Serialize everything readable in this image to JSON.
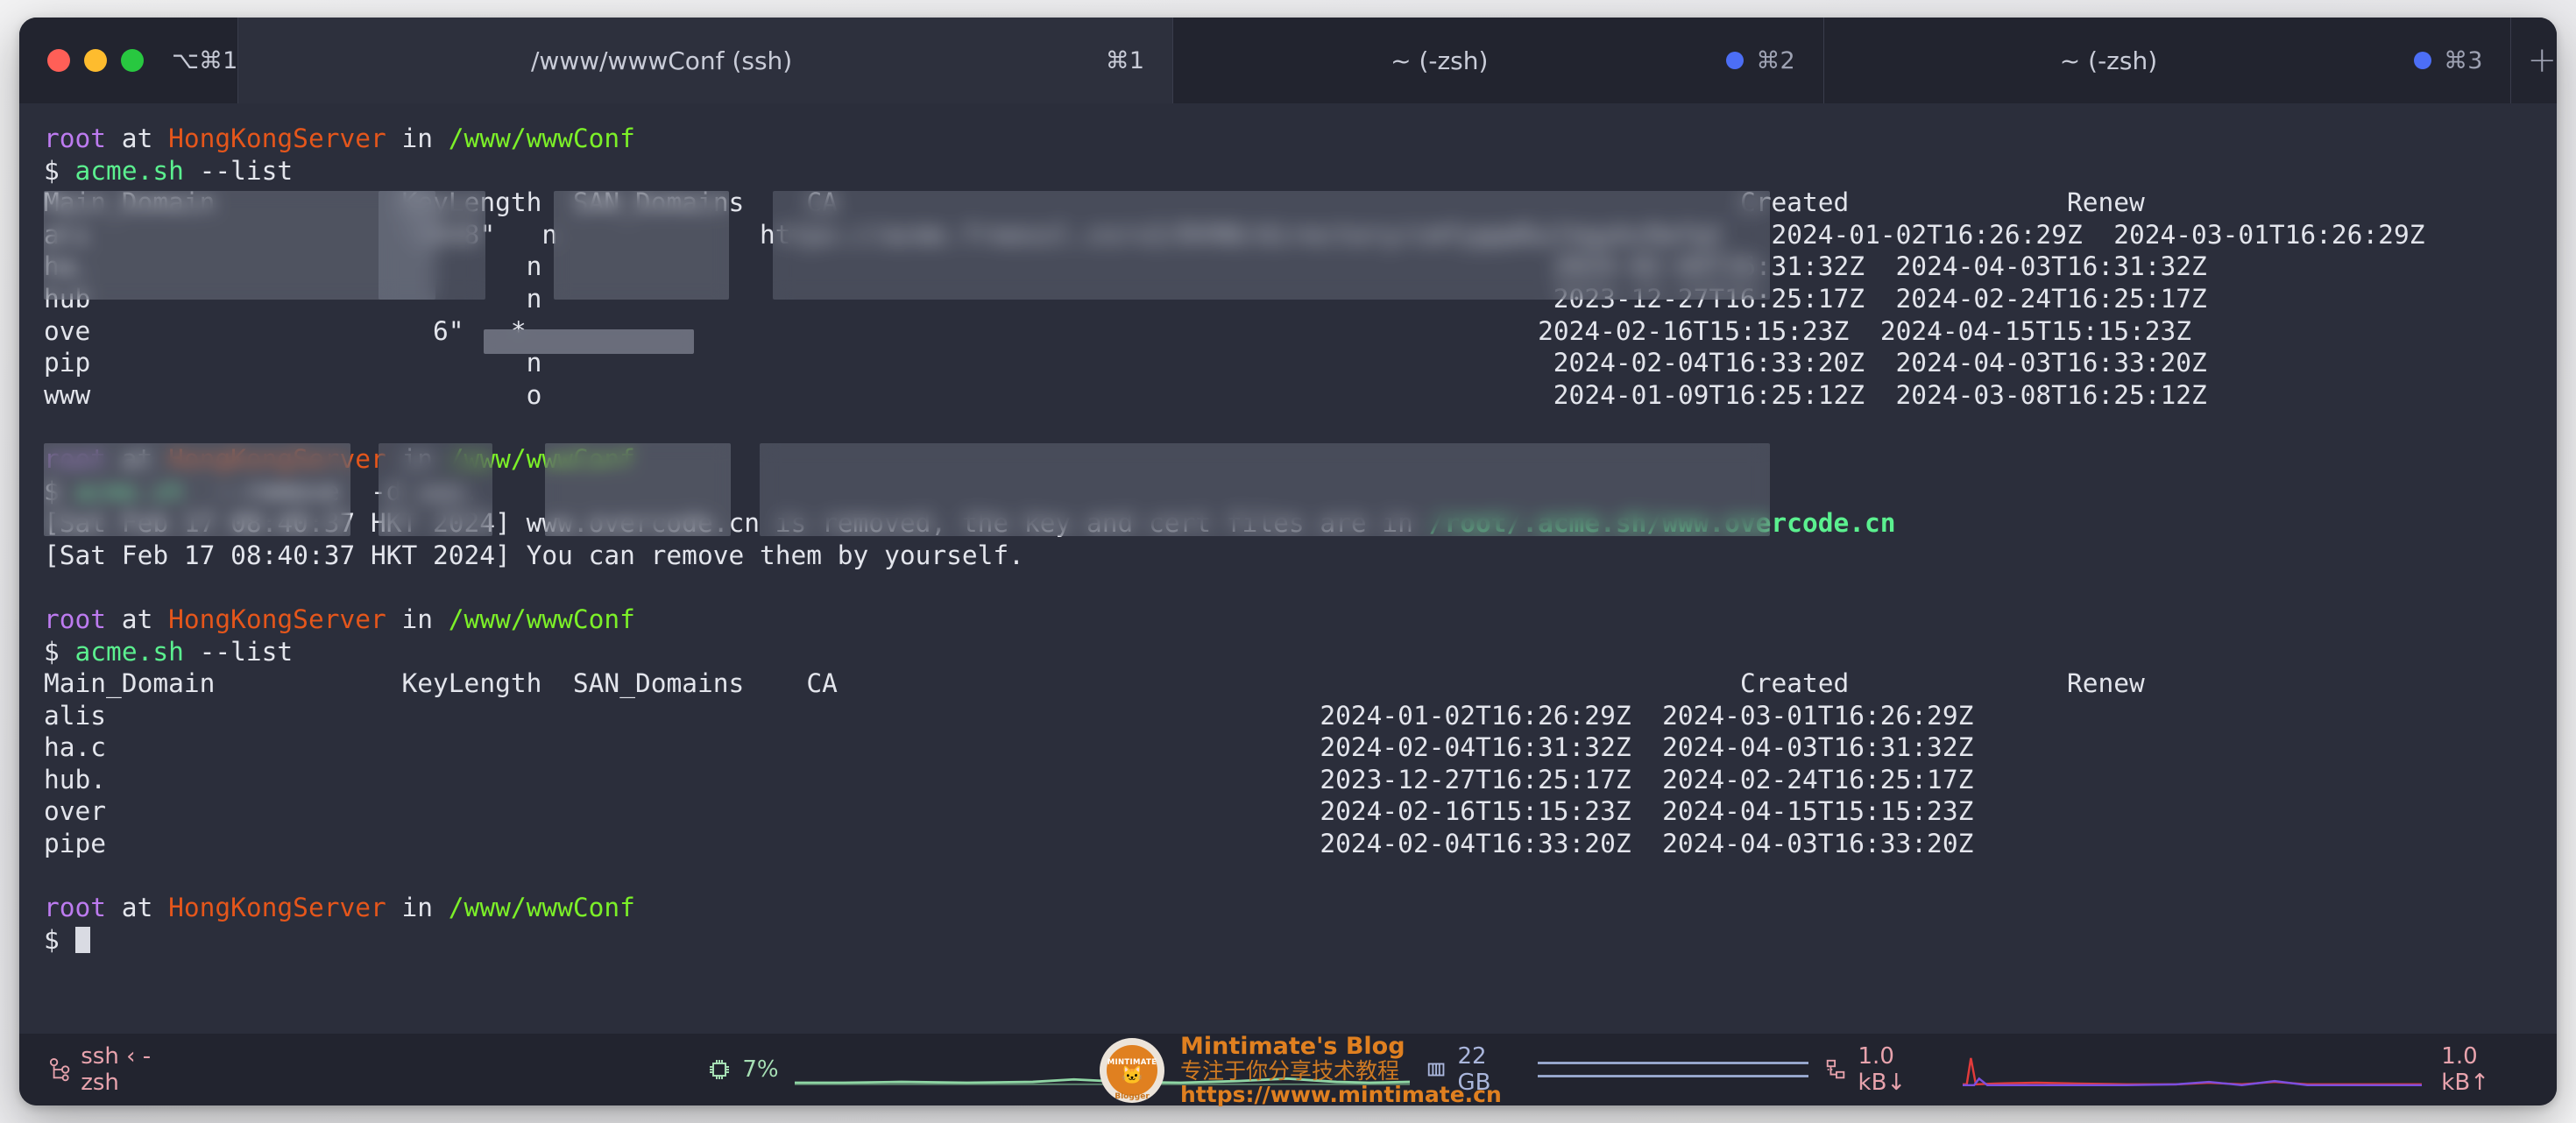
{
  "window": {
    "lights_shortcut": "⌥⌘1",
    "tabs": [
      {
        "title": "/www/wwwConf (ssh)",
        "key": "⌘1",
        "active": true,
        "dot": false
      },
      {
        "title": "~ (-zsh)",
        "key": "⌘2",
        "active": false,
        "dot": true
      },
      {
        "title": "~ (-zsh)",
        "key": "⌘3",
        "active": false,
        "dot": true
      }
    ],
    "new_tab_label": "+",
    "colors": {
      "tabbar_bg": "#22242f",
      "tab_active_bg": "#2d303d",
      "terminal_bg": "#2b2e3b",
      "dot_blue": "#4c6ef5",
      "light_red": "#ff5f57",
      "light_yellow": "#febc2e",
      "light_green": "#28c840"
    }
  },
  "prompt": {
    "user": "root",
    "at": " at ",
    "host": "HongKongServer",
    "in": " in ",
    "path": "/www/wwwConf",
    "sigil": "$ "
  },
  "terminal": {
    "commands": {
      "list": "acme.sh",
      "list_args": " --list",
      "remove": "acme.sh",
      "remove_args": "  --remove  -d www.",
      "remove_redacted": "              "
    },
    "table_headers": {
      "main_domain": "Main_Domain",
      "key_length": "KeyLength",
      "san_domains": "SAN_Domains",
      "ca": "CA",
      "created": "Created",
      "renew": "Renew"
    },
    "table1_rows": [
      {
        "domain_prefix": "ali",
        "san": "n",
        "created": "2024-01-02T16:26:29Z",
        "renew": "2024-03-01T16:26:29Z"
      },
      {
        "domain_prefix": "ha.",
        "san": "n",
        "created": "2024-02-04T16:31:32Z",
        "renew": "2024-04-03T16:31:32Z"
      },
      {
        "domain_prefix": "hub",
        "san": "n",
        "created": "2023-12-27T16:25:17Z",
        "renew": "2024-02-24T16:25:17Z"
      },
      {
        "domain_prefix": "ove",
        "san": "*",
        "created": "2024-02-16T15:15:23Z",
        "renew": "2024-04-15T15:15:23Z"
      },
      {
        "domain_prefix": "pip",
        "san": "n",
        "created": "2024-02-04T16:33:20Z",
        "renew": "2024-04-03T16:33:20Z"
      },
      {
        "domain_prefix": "www",
        "san": "o",
        "created": "2024-01-09T16:25:12Z",
        "renew": "2024-03-08T16:25:12Z"
      }
    ],
    "table1_partial_ca": "https://acme.freessl.cn/v2/DV90/directory/cmfygqdGulkgybz9afgt",
    "table1_partial_keylen": "\"2048\"",
    "table1_partial_keylen2": "6\"",
    "table2_rows": [
      {
        "domain_prefix": "alis",
        "created": "2024-01-02T16:26:29Z",
        "renew": "2024-03-01T16:26:29Z"
      },
      {
        "domain_prefix": "ha.c",
        "created": "2024-02-04T16:31:32Z",
        "renew": "2024-04-03T16:31:32Z"
      },
      {
        "domain_prefix": "hub.",
        "created": "2023-12-27T16:25:17Z",
        "renew": "2024-02-24T16:25:17Z"
      },
      {
        "domain_prefix": "over",
        "created": "2024-02-16T15:15:23Z",
        "renew": "2024-04-15T15:15:23Z"
      },
      {
        "domain_prefix": "pipe",
        "created": "2024-02-04T16:33:20Z",
        "renew": "2024-04-03T16:33:20Z"
      }
    ],
    "log_lines": [
      {
        "stamp": "[Sat Feb 17 08:40:37 HKT 2024] ",
        "text_before": "www.overcode.cn is removed, the key and cert files are in ",
        "highlight": "/root/.acme.sh/www.overcode.cn",
        "text_after": ""
      },
      {
        "stamp": "[Sat Feb 17 08:40:37 HKT 2024] ",
        "text_before": "You can remove them by yourself.",
        "highlight": "",
        "text_after": ""
      }
    ]
  },
  "statusbar": {
    "session_icon": "process-tree-icon",
    "session": "ssh ‹ -zsh",
    "cpu_icon": "cpu-chip-icon",
    "cpu": "7%",
    "mem_icon": "memory-chip-icon",
    "mem": "22 GB",
    "net_icon": "network-icon",
    "net_down": "1.0 kB↓",
    "net_up": "1.0 kB↑",
    "colors": {
      "session": "#e8a3ad",
      "cpu": "#a6dfb4",
      "mem": "#aab6dc",
      "net": "#e8a3ad",
      "cpu_spark": "#8fd6a4",
      "net_spark_red": "#e23b3b",
      "net_spark_purple": "#7a4fe0",
      "mem_spark": "#9fb0d8"
    }
  },
  "watermark": {
    "logo_label": "MINTIMATE",
    "logo_sub": "Blogger",
    "title": "Mintimate's Blog",
    "subtitle": "专注于你分享技术教程",
    "url": "https://www.mintimate.cn"
  }
}
